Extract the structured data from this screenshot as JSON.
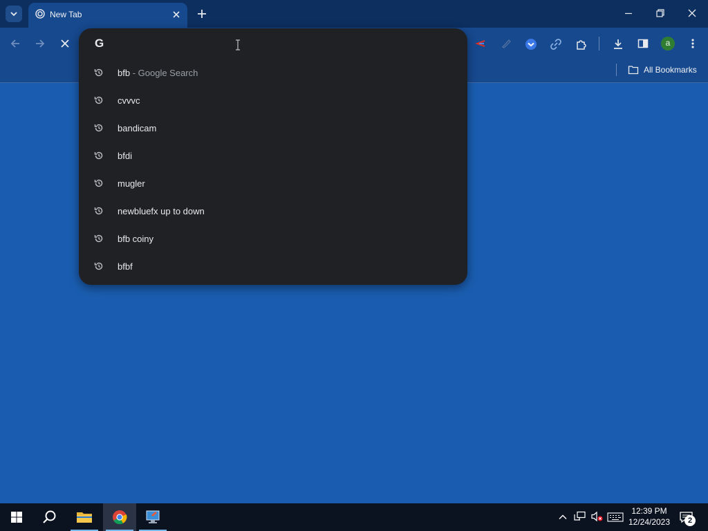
{
  "browser": {
    "tab": {
      "title": "New Tab"
    },
    "bookmarks_bar": {
      "all_bookmarks_label": "All Bookmarks"
    }
  },
  "omnibox": {
    "value": "",
    "search_engine_icon": "google-g-icon",
    "suggestions": [
      {
        "text": "bfb",
        "suffix": "- Google Search",
        "icon": "history-icon"
      },
      {
        "text": "cvvvc",
        "suffix": "",
        "icon": "history-icon"
      },
      {
        "text": "bandicam",
        "suffix": "",
        "icon": "history-icon"
      },
      {
        "text": "bfdi",
        "suffix": "",
        "icon": "history-icon"
      },
      {
        "text": "mugler",
        "suffix": "",
        "icon": "history-icon"
      },
      {
        "text": "newbluefx up to down",
        "suffix": "",
        "icon": "history-icon"
      },
      {
        "text": "bfb coiny",
        "suffix": "",
        "icon": "history-icon"
      },
      {
        "text": "bfbf",
        "suffix": "",
        "icon": "history-icon"
      }
    ]
  },
  "profile": {
    "initial": "a"
  },
  "taskbar": {
    "clock_time": "12:39 PM",
    "clock_date": "12/24/2023",
    "notification_count": "2"
  },
  "colors": {
    "page_background": "#1a5db0",
    "toolbar": "#17498f",
    "dropdown": "#202124"
  }
}
